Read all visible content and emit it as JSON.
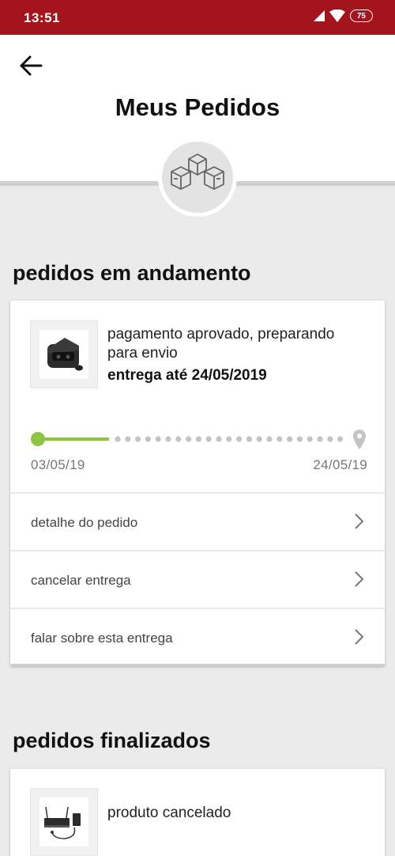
{
  "status_bar": {
    "time": "13:51",
    "battery": "75"
  },
  "header": {
    "title": "Meus Pedidos"
  },
  "sections": {
    "in_progress": "pedidos em andamento",
    "finished": "pedidos finalizados"
  },
  "active_order": {
    "status": "pagamento aprovado, preparando para envio",
    "delivery": "entrega até 24/05/2019",
    "start_date": "03/05/19",
    "end_date": "24/05/19",
    "actions": [
      {
        "label": "detalhe do pedido"
      },
      {
        "label": "cancelar entrega"
      },
      {
        "label": "falar sobre esta entrega"
      }
    ]
  },
  "finished_order": {
    "status": "produto cancelado"
  },
  "colors": {
    "brand": "#a3141c",
    "progress": "#8cc63f",
    "dots": "#c4c4c4"
  }
}
